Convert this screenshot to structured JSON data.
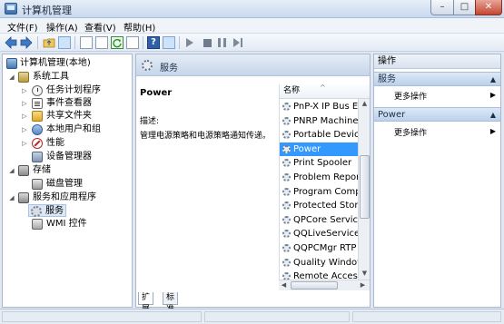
{
  "window": {
    "title": "计算机管理",
    "min_label": "–",
    "max_label": "□",
    "close_label": "✕"
  },
  "menu": [
    "文件(F)",
    "操作(A)",
    "查看(V)",
    "帮助(H)"
  ],
  "toolbar": {
    "help_label": "?"
  },
  "tree": {
    "root": "计算机管理(本地)",
    "system_tools": "系统工具",
    "task_scheduler": "任务计划程序",
    "event_viewer": "事件查看器",
    "shared_folders": "共享文件夹",
    "local_users": "本地用户和组",
    "performance": "性能",
    "device_manager": "设备管理器",
    "storage": "存储",
    "disk_management": "磁盘管理",
    "services_apps": "服务和应用程序",
    "services": "服务",
    "wmi": "WMI 控件"
  },
  "center": {
    "header": "服务",
    "selected_service": "Power",
    "description_label": "描述:",
    "description": "管理电源策略和电源策略通知传递。",
    "column_name": "名称",
    "services": [
      "PnP-X IP Bus En",
      "PNRP Machine",
      "Portable Device",
      "Power",
      "Print Spooler",
      "Problem Repor",
      "Program Comp",
      "Protected Stora",
      "QPCore Service",
      "QQLiveService",
      "QQPCMgr RTP",
      "Quality Window",
      "Remote Access"
    ],
    "selected_index": 3,
    "tabs": [
      "扩展",
      "标准"
    ]
  },
  "actions": {
    "header": "操作",
    "group1": "服务",
    "group1_item": "更多操作",
    "group2": "Power",
    "group2_item": "更多操作"
  }
}
